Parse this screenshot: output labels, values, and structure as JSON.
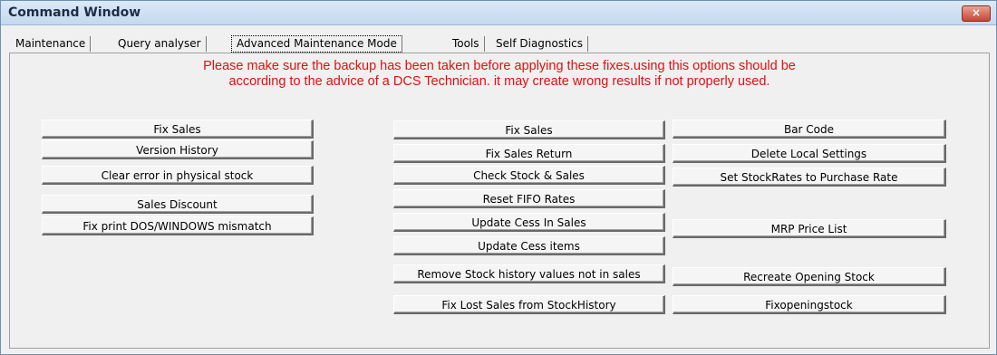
{
  "window": {
    "title": "Command Window",
    "close_label": "×"
  },
  "tabs": [
    "Maintenance",
    "Query analyser",
    "Advanced Maintenance Mode",
    "Tools",
    "Self Diagnostics"
  ],
  "warning": {
    "line1": "Please make sure the backup has been taken before applying these fixes.using this options  should be",
    "line2": "according to the advice of a DCS Technician. it may create wrong results if not properly used."
  },
  "left_buttons": [
    "Fix Sales",
    "Version History",
    "Clear error in physical stock",
    "Sales Discount",
    "Fix print DOS/WINDOWS mismatch"
  ],
  "middle_buttons": [
    "Fix Sales",
    "Fix Sales Return",
    "Check Stock & Sales",
    "Reset FIFO Rates",
    "Update Cess In Sales",
    "Update Cess items",
    "Remove Stock history values not in sales",
    "Fix Lost Sales from StockHistory"
  ],
  "right_buttons": [
    "Bar Code",
    "Delete Local Settings",
    "Set StockRates to Purchase Rate",
    "MRP Price List",
    "Recreate Opening Stock",
    "Fixopeningstock"
  ]
}
